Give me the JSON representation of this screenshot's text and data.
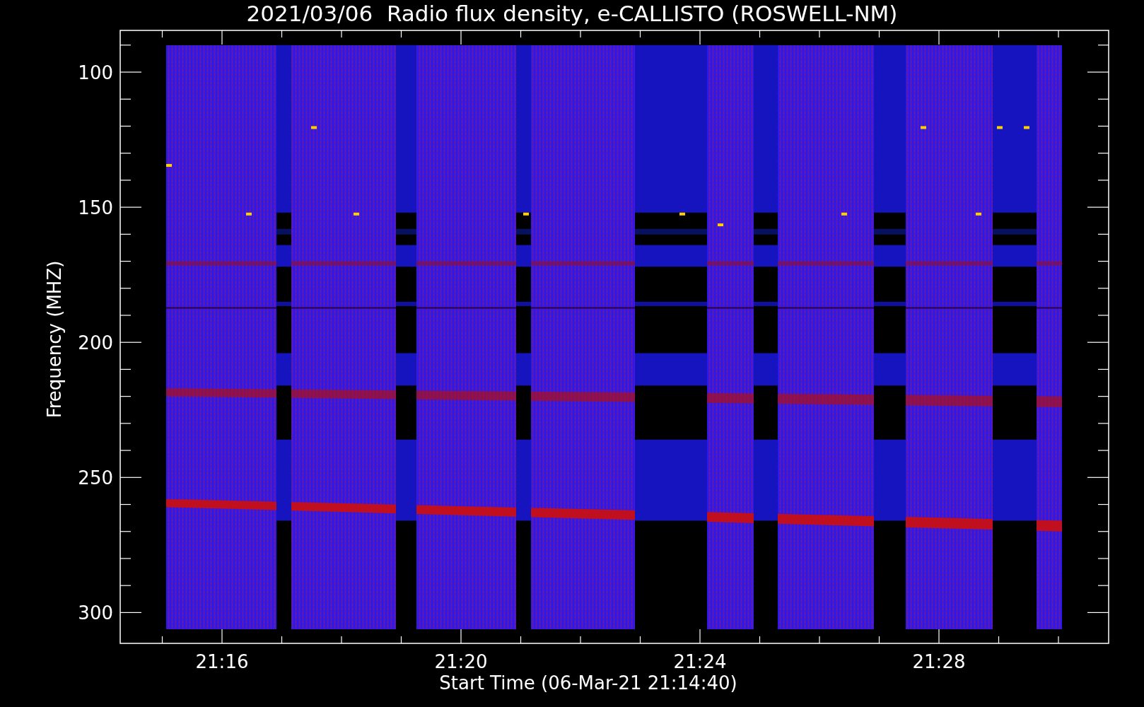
{
  "title": "2021/03/06  Radio flux density, e-CALLISTO (ROSWELL-NM)",
  "y_axis": {
    "label": "Frequency (MHZ)",
    "ticks": [
      "100",
      "150",
      "200",
      "250",
      "300"
    ]
  },
  "x_axis": {
    "label": "Start Time (06-Mar-21 21:14:40)",
    "ticks": [
      "21:16",
      "21:20",
      "21:24",
      "21:28"
    ]
  }
}
